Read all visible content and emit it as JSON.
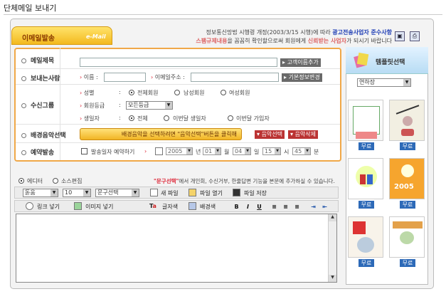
{
  "page": {
    "title": "단체메일 보내기"
  },
  "tab": {
    "title": "이메일발송",
    "sub": "e-Mail"
  },
  "notice": {
    "l1a": "정보통신망법 시행령 개정(2003/3/15 시행)에 따라",
    "l1b": "광고전송사업자 준수사항",
    "l2a": "스팸규제내용",
    "l2b": "을 꼼꼼히 확인할으로써 회원에게",
    "l2c": "신뢰받는 사업자",
    "l2d": "가 되시기 바랍니다"
  },
  "form": {
    "subject_label": "메일제목",
    "subject_value": "",
    "subject_btn": "고객이름추가",
    "sender_label": "보내는사람",
    "name_label": "이름 :",
    "name_value": "",
    "email_label": "이메일주소 :",
    "email_value": "",
    "sender_btn": "기본정보변경",
    "group_label": "수신그룹",
    "gender_label": "성별",
    "gender_opts": [
      "전체회원",
      "남성회원",
      "여성회원"
    ],
    "grade_label": "회원등급",
    "grade_value": "모든등급",
    "birth_label": "생일자",
    "birth_opts": [
      "전체",
      "이번달 생일자",
      "이번달 가입자"
    ],
    "music_label": "배경음악선택",
    "music_text": "배경음악을 선택하려면 \"음악선택\"버튼을 클릭해",
    "music_btn": "음악선택",
    "music_del": "음악삭제",
    "reserve_label": "예약발송",
    "reserve_chk": "발송일자 예약하기",
    "year": "2005",
    "year_u": "년",
    "month": "01",
    "month_u": "월",
    "day": "04",
    "day_u": "일",
    "hour": "15",
    "hour_u": "시",
    "min": "45",
    "min_u": "분"
  },
  "editor": {
    "mode_editor": "에디터",
    "mode_source": "소스편집",
    "warn_red": "\"문구선택\"",
    "warn": "에서 개인회, 수신거부, 한줄답변 기능을 본문에 추가하실 수 있습니다.",
    "font": "돋움",
    "size": "10",
    "phrase": "문구선택",
    "new_file": "새 파일",
    "open_file": "파일 열기",
    "save_file": "파일 저장",
    "link": "링크 넣기",
    "image": "이미지 넣기",
    "font_color": "글자색",
    "bg_color": "배경색",
    "bold": "B",
    "italic": "I",
    "underline": "U",
    "body": ""
  },
  "template": {
    "title": "템플릿선택",
    "category": "연하장",
    "select": "무료",
    "year": "2005"
  },
  "colors": {
    "accent": "#f3b91e",
    "link": "#1d3cb4",
    "red": "#d23"
  }
}
